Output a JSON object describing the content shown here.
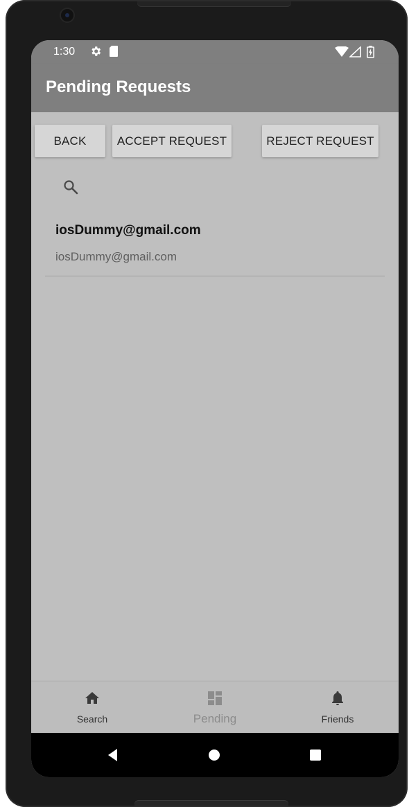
{
  "status_bar": {
    "time": "1:30",
    "icons": [
      "gear-icon",
      "sd-card-icon",
      "wifi-icon",
      "signal-icon",
      "battery-charging-icon"
    ]
  },
  "app_bar": {
    "title": "Pending Requests"
  },
  "actions": {
    "back_label": "BACK",
    "accept_label": "ACCEPT REQUEST",
    "reject_label": "REJECT REQUEST"
  },
  "search": {
    "icon": "search-icon"
  },
  "requests": [
    {
      "title": "iosDummy@gmail.com",
      "subtitle": "iosDummy@gmail.com"
    }
  ],
  "bottom_nav": {
    "items": [
      {
        "label": "Search",
        "icon": "home-icon"
      },
      {
        "label": "Pending",
        "icon": "dashboard-icon",
        "active": true
      },
      {
        "label": "Friends",
        "icon": "bell-icon"
      }
    ]
  },
  "system_nav": {
    "icons": [
      "back-triangle-icon",
      "home-circle-icon",
      "recents-square-icon"
    ]
  },
  "colors": {
    "app_bar": "#7f7f7f",
    "background": "#bfbfbf",
    "button": "#d6d6d6",
    "system_nav": "#000000"
  }
}
